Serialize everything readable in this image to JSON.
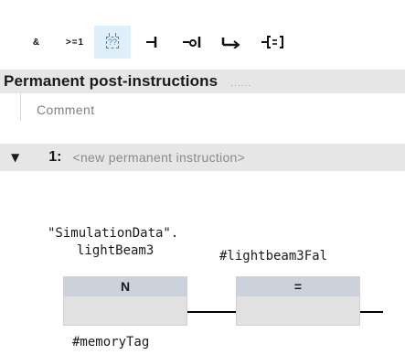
{
  "toolbar": {
    "buttons": [
      {
        "label": "&",
        "icon": "and-box-icon"
      },
      {
        "label": ">=1",
        "icon": "or-box-icon"
      },
      {
        "label": "??",
        "icon": "empty-box-icon",
        "active": true
      },
      {
        "label": "-|",
        "icon": "no-contact-icon"
      },
      {
        "label": "-o|",
        "icon": "nc-contact-icon"
      },
      {
        "label": "|->",
        "icon": "open-branch-icon"
      },
      {
        "label": "-[=]",
        "icon": "assignment-icon"
      }
    ]
  },
  "section": {
    "title": "Permanent post-instructions",
    "dots": "......",
    "comment": "Comment"
  },
  "network": {
    "toggle": "▼",
    "number": "1:",
    "title": "<new permanent instruction>"
  },
  "logic": {
    "block1": {
      "operand_line1": "\"SimulationData\".",
      "operand_line2": "lightBeam3",
      "type": "N",
      "bottom_operand": "#memoryTag"
    },
    "block2": {
      "operand": "#lightbeam3Fal",
      "type": "="
    }
  },
  "colors": {
    "header_bg": "#e6e6e6",
    "block_head": "#ccd2dc",
    "block_body": "#e1e1e1",
    "active_button": "#dff0fa"
  }
}
